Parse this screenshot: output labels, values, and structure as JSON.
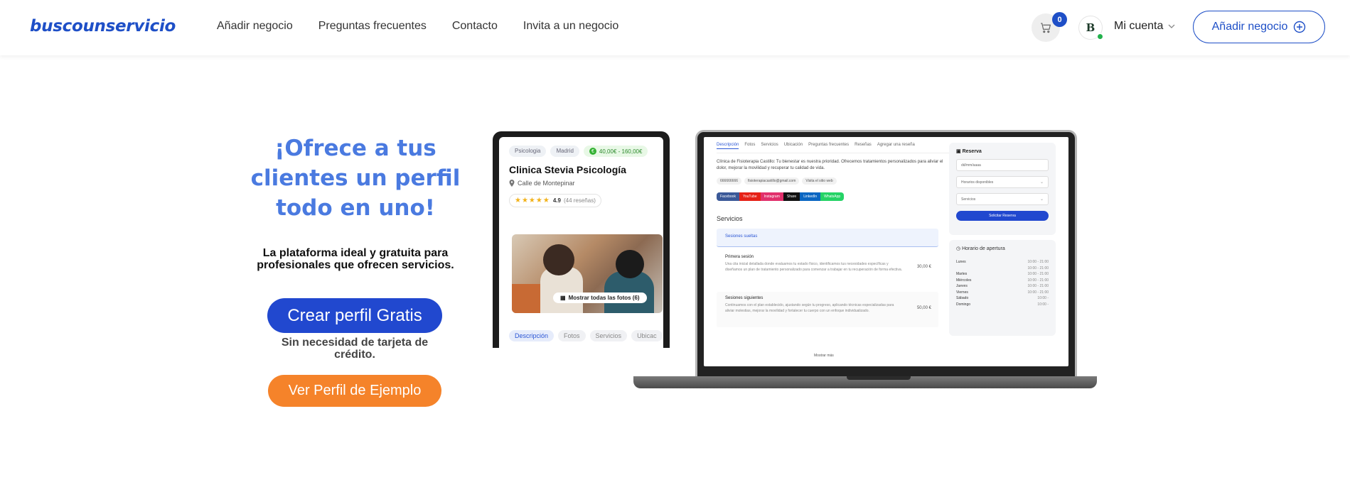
{
  "header": {
    "logo": "buscounservicio",
    "nav": [
      "Añadir negocio",
      "Preguntas frecuentes",
      "Contacto",
      "Invita a un negocio"
    ],
    "cart_count": "0",
    "avatar_letter": "B",
    "account_label": "Mi cuenta",
    "add_business_label": "Añadir negocio"
  },
  "hero": {
    "title": "¡Ofrece a tus clientes un perfil todo en uno!",
    "subtitle": "La plataforma ideal y gratuita para profesionales que ofrecen servicios.",
    "create_button": "Crear perfil Gratis",
    "no_card_text": "Sin necesidad de tarjeta de crédito.",
    "example_button": "Ver Perfil de Ejemplo"
  },
  "tablet": {
    "tags": [
      "Psicologia",
      "Madrid"
    ],
    "price": "40,00€ - 160,00€",
    "clinic_name": "Clinica Stevia Psicología",
    "address": "Calle de Montepinar",
    "rating": "4.9",
    "reviews": "(44 reseñas)",
    "show_photos": "Mostrar todas las fotos (6)",
    "tabs": [
      "Descripción",
      "Fotos",
      "Servicios",
      "Ubicac"
    ]
  },
  "laptop": {
    "tabs": [
      "Descripción",
      "Fotos",
      "Servicios",
      "Ubicación",
      "Preguntas frecuentes",
      "Reseñas",
      "Agregar una reseña"
    ],
    "description": "Clínica de Fisioterapia Castillo: Tu bienestar es nuestra prioridad. Ofrecemos tratamientos personalizados para aliviar el dolor, mejorar la movilidad y recuperar tu calidad de vida.",
    "contacts": [
      "666666666",
      "fisioterapiacastillo@gmail.com",
      "Visita el sitio web"
    ],
    "social": [
      "Facebook",
      "YouTube",
      "Instagram",
      "Share",
      "LinkedIn",
      "WhatsApp"
    ],
    "services_title": "Servicios",
    "sessions_label": "Sesiones sueltas",
    "items": [
      {
        "title": "Primera sesión",
        "desc": "Una cita inicial detallada donde evaluamos tu estado físico, identificamos tus necesidades específicas y diseñamos un plan de tratamiento personalizado para comenzar a trabajar en tu recuperación de forma efectiva.",
        "price": "30,00 €"
      },
      {
        "title": "Sesiones siguientes",
        "desc": "Continuamos con el plan establecido, ajustando según tu progreso, aplicando técnicas especializadas para aliviar molestias, mejorar la movilidad y fortalecer tu cuerpo con un enfoque individualizado.",
        "price": "50,00 €"
      }
    ],
    "show_more": "Mostrar más",
    "reserve_title": "Reserva",
    "date_value": "dd/mm/aaaa",
    "hours_select": "Horarios disponibles",
    "services_select": "Servicios",
    "request_button": "Solicitar Reserva",
    "hours_title": "Horario de apertura",
    "hours": [
      {
        "day": "Lunes",
        "time": "10:00 - 21:00"
      },
      {
        "day": "",
        "time": "10:00 - 21:00"
      },
      {
        "day": "Martes",
        "time": "10:00 - 21:00"
      },
      {
        "day": "Miércoles",
        "time": "10:00 - 21:00"
      },
      {
        "day": "Jueves",
        "time": "10:00 - 21:00"
      },
      {
        "day": "Viernes",
        "time": "10:00 - 21:00"
      },
      {
        "day": "Sábado",
        "time": "10:00 -"
      },
      {
        "day": "Domingo",
        "time": "10:00 -"
      }
    ]
  },
  "colors": {
    "brand_blue": "#1e4fc7",
    "hero_title": "#4a7ae0",
    "create_button": "#2148cf",
    "example_button": "#f5832a",
    "online_dot": "#22b14c"
  }
}
